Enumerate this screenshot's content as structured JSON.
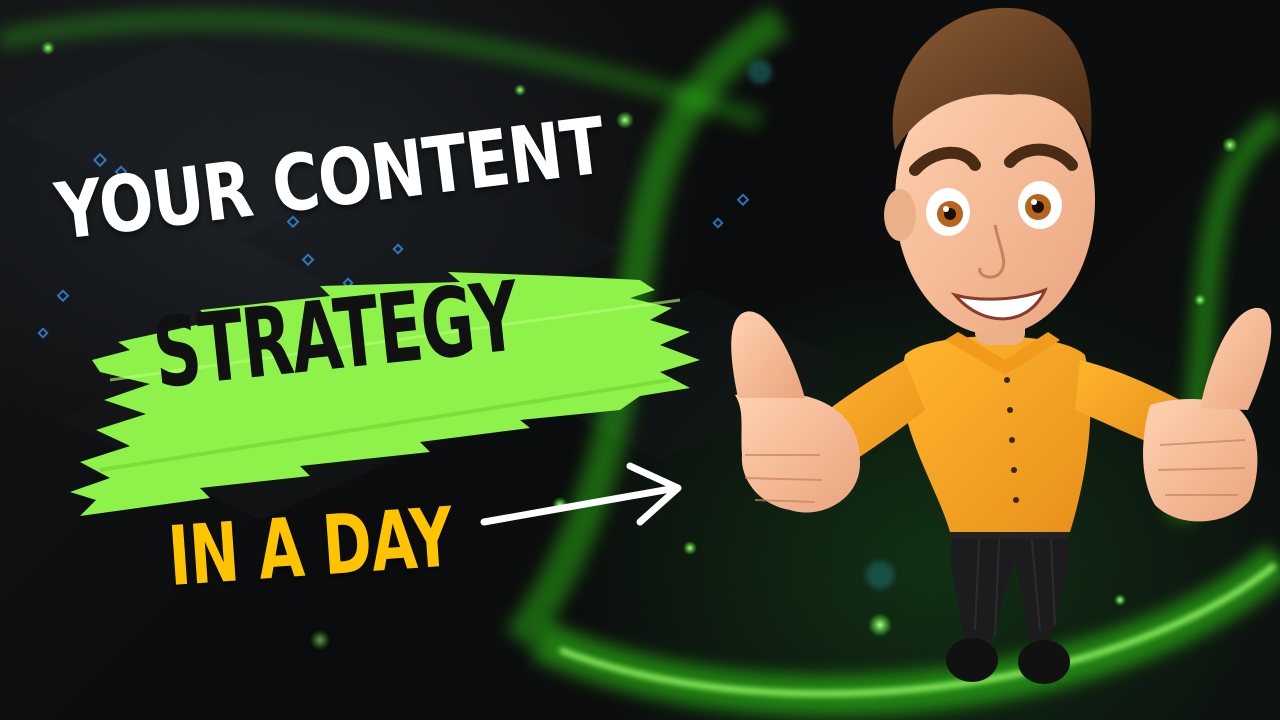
{
  "thumbnail": {
    "headline_line1": "YOUR CONTENT",
    "headline_line2": "STRATEGY",
    "headline_line3": "IN A DAY"
  },
  "colors": {
    "background": "#0a0b0c",
    "glow_green": "#39ff14",
    "brush_green": "#8ef24a",
    "line1_text": "#ffffff",
    "line2_text": "#111111",
    "line3_text": "#ffc400",
    "arrow": "#ffffff",
    "shirt": "#f5a623"
  },
  "icons": {
    "arrow": "right-arrow-icon",
    "character": "cartoon-man-thumbs-up"
  }
}
